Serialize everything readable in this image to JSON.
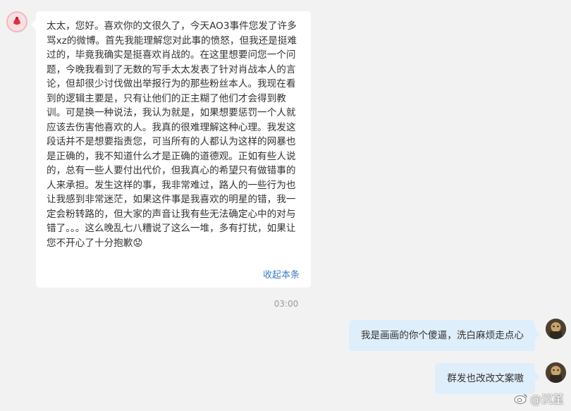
{
  "incoming_message": {
    "text": "太太，您好。喜欢你的文很久了，今天AO3事件您发了许多骂xz的微博。首先我能理解您对此事的愤怒，但我还是挺难过的，毕竟我确实是挺喜欢肖战的。在这里想要问您一个问题，今晚我看到了无数的写手太太发表了针对肖战本人的言论，但却很少讨伐做出举报行为的那些粉丝本人。我现在看到的逻辑主要是，只有让他们的正主糊了他们才会得到教训。可是换一种说法，我认为就是，如果想要惩罚一个人就应该去伤害他喜欢的人。我真的很难理解这种心理。我发这段话并不是想要指责您，可当所有的人都认为这样的网暴也是正确的，我不知道什么才是正确的道德观。正如有些人说的，总有一些人要付出代价，但我真心的希望只有做错事的人来承担。发生这样的事，我非常难过，路人的一些行为也让我感到非常迷茫，如果这件事是我喜欢的明星的错，我一定会粉转路的，但大家的声音让我有些无法确定心中的对与错了。。。这么晚乱七八糟说了这么一堆，多有打扰，如果让您不开心了十分抱歉😟",
    "collapse_label": "收起本条"
  },
  "timestamp": "03:00",
  "outgoing_messages": [
    {
      "text": "我是画画的你个傻逼，洗白麻烦走点心"
    },
    {
      "text": "群发也改改文案嗷"
    }
  ],
  "watermark": {
    "text": "@沉堇"
  },
  "colors": {
    "background": "#f2f2f2",
    "outgoing_bubble": "#dfeefb",
    "link": "#3b7ec1"
  }
}
